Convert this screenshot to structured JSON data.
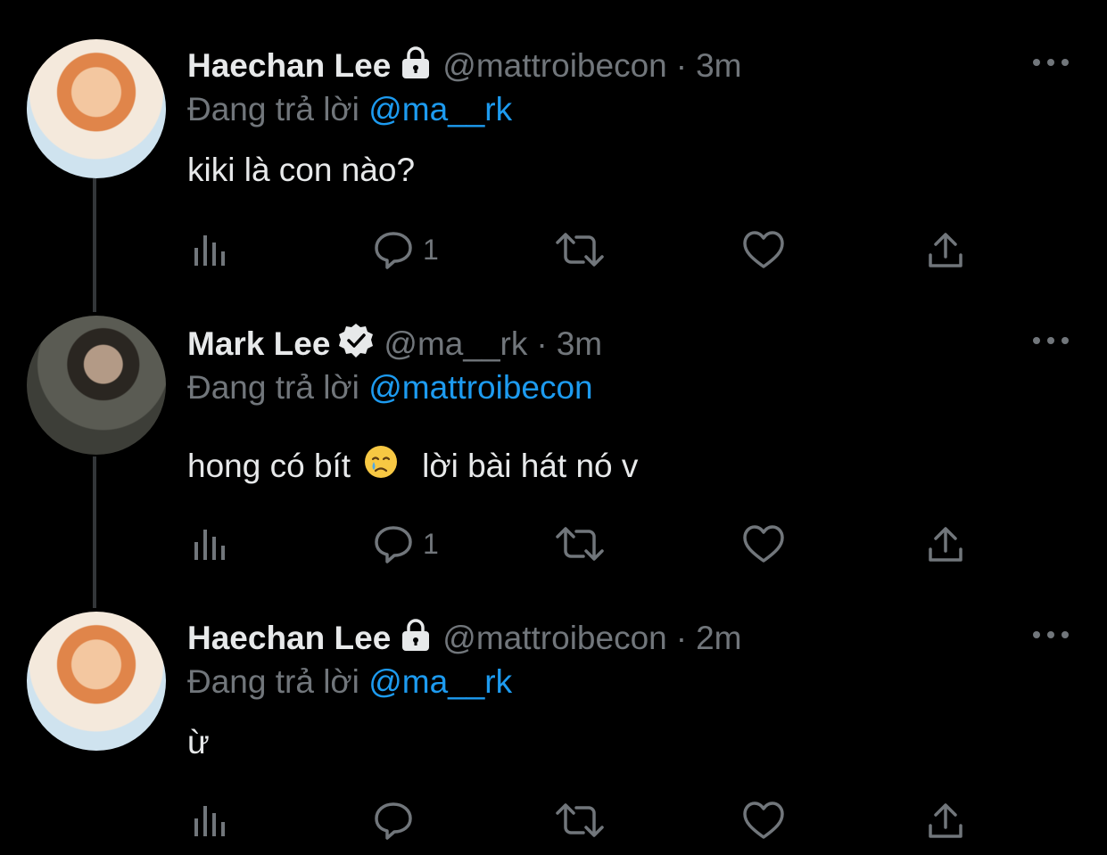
{
  "tweets": [
    {
      "name": "Haechan Lee",
      "badge": "lock-icon",
      "handle": "@mattroibecon",
      "time": "3m",
      "reply_prefix": "Đang trả lời",
      "reply_to": "@ma__rk",
      "text": "kiki là con nào?",
      "reply_count": "1"
    },
    {
      "name": "Mark Lee",
      "badge": "verified-icon",
      "handle": "@ma__rk",
      "time": "3m",
      "reply_prefix": "Đang trả lời",
      "reply_to": "@mattroibecon",
      "text_before_emoji": "hong có bít",
      "emoji": "crying-face-emoji",
      "text_after_emoji": "lời bài hát nó v",
      "reply_count": "1"
    },
    {
      "name": "Haechan Lee",
      "badge": "lock-icon",
      "handle": "@mattroibecon",
      "time": "2m",
      "reply_prefix": "Đang trả lời",
      "reply_to": "@ma__rk",
      "text": "ừ",
      "reply_count": ""
    }
  ],
  "separator": "·",
  "colors": {
    "background": "#000000",
    "primary_text": "#e7e9ea",
    "secondary_text": "#71767b",
    "link": "#1d9bf0"
  }
}
